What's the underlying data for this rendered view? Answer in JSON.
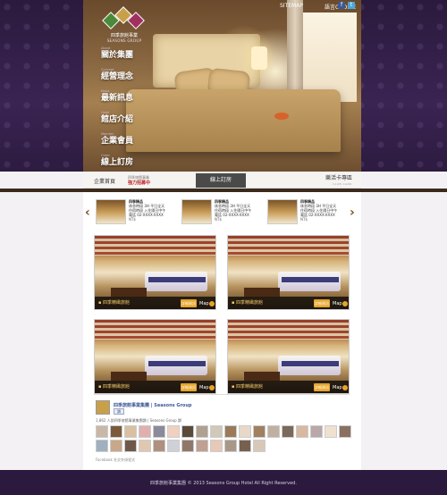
{
  "header": {
    "logo": {
      "name_cn": "四季旅館事業",
      "name_en": "SEASONS GROUP"
    },
    "top_links": [
      "SITEMAP",
      "語言CHOICE"
    ],
    "nav": [
      {
        "en": "About",
        "label": "關於集團"
      },
      {
        "en": "Concept",
        "label": "經營理念"
      },
      {
        "en": "News",
        "label": "最新訊息"
      },
      {
        "en": "Hotel",
        "label": "館店介紹"
      },
      {
        "en": "Member",
        "label": "企業會員"
      },
      {
        "en": "Order",
        "label": "線上訂房"
      }
    ]
  },
  "subbar": {
    "home": "企業首頁",
    "promo_small": "四季旅館事業",
    "promo_main": "強力招募中",
    "booking": "線上訂房",
    "music": "樂活卡專區",
    "music_sub": "CLUB CARD"
  },
  "carousel": {
    "hotels": [
      {
        "name": "四季精品",
        "lines": [
          "休息時段 3H 平日全天",
          "住宿時段 入住隔日中午",
          "電話 02-XXXX-XXXX"
        ],
        "price": "NT$"
      },
      {
        "name": "四季精品",
        "lines": [
          "休息時段 3H 平日全天",
          "住宿時段 入住隔日中午",
          "電話 02-XXXX-XXXX"
        ],
        "price": "NT$"
      },
      {
        "name": "四季精品",
        "lines": [
          "休息時段 3H 平日全天",
          "住宿時段 入住隔日中午",
          "電話 02-XXXX-XXXX"
        ],
        "price": "NT$"
      }
    ]
  },
  "rooms": [
    {
      "title": "▪ 四季精緻旅館",
      "button": "詳細資訊",
      "tag": "Map"
    },
    {
      "title": "▪ 四季精緻旅館",
      "button": "詳細資訊",
      "tag": "Map"
    },
    {
      "title": "▪ 四季精緻旅館",
      "button": "詳細資訊",
      "tag": "Map"
    },
    {
      "title": "▪ 四季精緻旅館",
      "button": "詳細資訊",
      "tag": "Map"
    }
  ],
  "facebook": {
    "page_name": "四季旅館事業集團 | Seasons Group",
    "like_label": "讚",
    "like_count": "1,862 人說四季旅館事業集團讚 | Seasons Group 讚",
    "plugin": "Facebook 社交外掛程式",
    "face_colors": [
      "#c9b8a8",
      "#7a5a3a",
      "#d8c0a0",
      "#e0b0b0",
      "#8a8a9a",
      "#f0d0c0",
      "#5a4a3a",
      "#b0a090",
      "#d0c8b8",
      "#9a7a5a",
      "#e8d8c8",
      "#a08060",
      "#c0b0a0",
      "#7a6a5a",
      "#d8b8a0",
      "#b8a8a8",
      "#f0e0d0",
      "#8a7060",
      "#a0b0c0",
      "#c8a888",
      "#705848",
      "#e0c8b0",
      "#b09080",
      "#d0d0d8",
      "#907868",
      "#c0a090",
      "#e8c8b8",
      "#a89888",
      "#786050",
      "#d8c8b8"
    ]
  },
  "footer": {
    "text": "四季旅館事業集團 © 2013 Seasons Group Hotel All Right Reserved."
  }
}
